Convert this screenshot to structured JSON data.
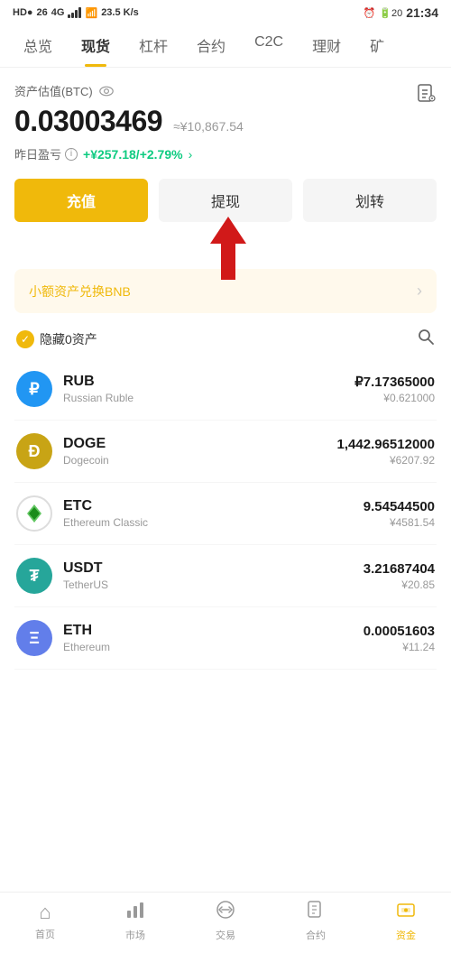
{
  "statusBar": {
    "left": "HD● 26 46",
    "speed": "23.5 K/s",
    "time": "21:34"
  },
  "navTabs": {
    "items": [
      "总览",
      "现货",
      "杠杆",
      "合约",
      "C2C",
      "理财",
      "矿"
    ],
    "activeIndex": 1
  },
  "assetSection": {
    "label": "资产估值(BTC)",
    "btcValue": "0.03003469",
    "cnyApprox": "≈¥10,867.54",
    "profitLabel": "昨日盈亏",
    "profitValue": "+¥257.18/+2.79%"
  },
  "buttons": {
    "charge": "充值",
    "withdraw": "提现",
    "transfer": "划转"
  },
  "swapBanner": {
    "text": "小额资产兑换BNB",
    "arrow": "›"
  },
  "filterRow": {
    "hideLabel": "隐藏0资产"
  },
  "assets": [
    {
      "symbol": "RUB",
      "name": "Russian Ruble",
      "balance": "₽7.17365000",
      "cny": "¥0.621000",
      "iconType": "rub",
      "iconText": "₽"
    },
    {
      "symbol": "DOGE",
      "name": "Dogecoin",
      "balance": "1,442.96512000",
      "cny": "¥6207.92",
      "iconType": "doge",
      "iconText": "Ð"
    },
    {
      "symbol": "ETC",
      "name": "Ethereum Classic",
      "balance": "9.54544500",
      "cny": "¥4581.54",
      "iconType": "etc",
      "iconText": "◆"
    },
    {
      "symbol": "USDT",
      "name": "TetherUS",
      "balance": "3.21687404",
      "cny": "¥20.85",
      "iconType": "usdt",
      "iconText": "₮"
    },
    {
      "symbol": "ETH",
      "name": "Ethereum",
      "balance": "0.00051603",
      "cny": "¥11.24",
      "iconType": "eth",
      "iconText": "Ξ"
    }
  ],
  "bottomNav": {
    "items": [
      {
        "label": "首页",
        "icon": "⌂",
        "active": false
      },
      {
        "label": "市场",
        "icon": "▐▌",
        "active": false
      },
      {
        "label": "交易",
        "icon": "⇄",
        "active": false
      },
      {
        "label": "合约",
        "icon": "📄",
        "active": false
      },
      {
        "label": "资金",
        "icon": "💼",
        "active": true
      }
    ]
  }
}
